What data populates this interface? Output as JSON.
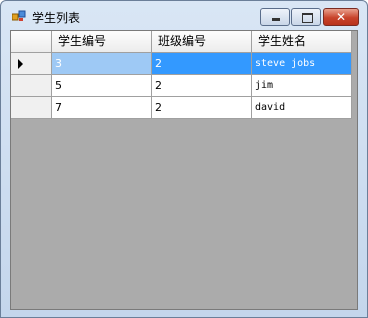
{
  "window": {
    "title": "学生列表"
  },
  "grid": {
    "columns": [
      "学生编号",
      "班级编号",
      "学生姓名"
    ],
    "rows": [
      {
        "student_id": "3",
        "class_id": "2",
        "name": "steve jobs",
        "selected": true
      },
      {
        "student_id": "5",
        "class_id": "2",
        "name": "jim",
        "selected": false
      },
      {
        "student_id": "7",
        "class_id": "2",
        "name": "david",
        "selected": false
      }
    ]
  },
  "icons": {
    "app": "app-icon",
    "minimize": "minimize-icon",
    "maximize": "maximize-icon",
    "close": "close-icon",
    "current_row": "current-row-arrow-icon"
  },
  "colors": {
    "selection": "#3399ff",
    "empty_area": "#ababab",
    "close_button": "#c8432b"
  }
}
